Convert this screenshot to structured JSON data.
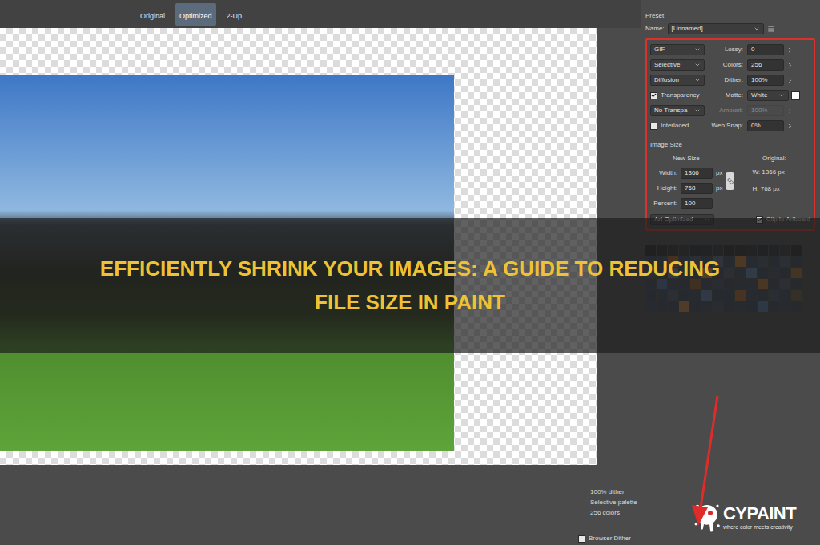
{
  "tabs": [
    {
      "label": "Original",
      "selected": false
    },
    {
      "label": "Optimized",
      "selected": true
    },
    {
      "label": "2-Up",
      "selected": false
    }
  ],
  "preset": {
    "label": "Preset",
    "name_label": "Name:",
    "name_value": "[Unnamed]"
  },
  "settings": [
    {
      "left": {
        "kind": "dropdown",
        "text": "GIF",
        "checked": false
      },
      "right": {
        "kind": "stepper",
        "label": "Lossy:",
        "value": "0",
        "disabled": false
      }
    },
    {
      "left": {
        "kind": "dropdown",
        "text": "Selective",
        "checked": false
      },
      "right": {
        "kind": "stepper",
        "label": "Colors:",
        "value": "256",
        "disabled": false
      }
    },
    {
      "left": {
        "kind": "dropdown",
        "text": "Diffusion",
        "checked": false
      },
      "right": {
        "kind": "stepper",
        "label": "Dither:",
        "value": "100%",
        "disabled": false
      }
    },
    {
      "left": {
        "kind": "checkbox",
        "text": "Transparency",
        "checked": true
      },
      "right": {
        "kind": "matte",
        "label": "Matte:",
        "value": "White",
        "disabled": false
      }
    },
    {
      "left": {
        "kind": "dropdown",
        "text": "No Transpa",
        "checked": false
      },
      "right": {
        "kind": "stepper",
        "label": "Amount:",
        "value": "100%",
        "disabled": true
      }
    },
    {
      "left": {
        "kind": "checkbox",
        "text": "Interlaced",
        "checked": false
      },
      "right": {
        "kind": "stepper",
        "label": "Web Snap:",
        "value": "0%",
        "disabled": false
      }
    }
  ],
  "image_size": {
    "title": "Image Size",
    "new_size": "New Size",
    "original": "Original:",
    "linked": true,
    "fields": [
      {
        "label": "Width:",
        "value": "1366",
        "unit": "px"
      },
      {
        "label": "Height:",
        "value": "768",
        "unit": "px"
      }
    ],
    "original_dims": [
      "W: 1366 px",
      "H: 768 px"
    ],
    "percent": {
      "label": "Percent:",
      "value": "100"
    },
    "quality": "Art Optimized",
    "clip": {
      "label": "Clip to Artboard",
      "checked": true
    }
  },
  "color_table": [
    "#262626",
    "#2b2b2b",
    "#2f2f2f",
    "#333333",
    "#2a2d31",
    "#2c2f34",
    "#303338",
    "#282a2e",
    "#2d2d2d",
    "#313131",
    "#292c30",
    "#2e3136",
    "#33363b",
    "#2b2b2b",
    "#3a4452",
    "#3d4858",
    "#a35f2a",
    "#3b4553",
    "#4a5565",
    "#3a4554",
    "#5a6a7e",
    "#3c4756",
    "#b8772f",
    "#3e4959",
    "#465262",
    "#3a4452",
    "#4e5b6c",
    "#3b4655",
    "#445162",
    "#3a4452",
    "#6a7d92",
    "#3c4757",
    "#3f4a5a",
    "#c28a3e",
    "#3a4554",
    "#4b5868",
    "#3d4858",
    "#5a7fa6",
    "#3b4655",
    "#424e5e",
    "#3a4452",
    "#9a6a35",
    "#3b4655",
    "#4a6f98",
    "#3c4757",
    "#3a4452",
    "#8c5a2a",
    "#3d4858",
    "#455262",
    "#3a4452",
    "#3c4757",
    "#3f4a5a",
    "#b0702f",
    "#3a4554",
    "#4d5a6b",
    "#3b4655",
    "#3a4452",
    "#3e4959",
    "#4c5969",
    "#3a4452",
    "#3c4757",
    "#5c7aa0",
    "#3a4554",
    "#3b4655",
    "#a8662c",
    "#3d4858",
    "#3a4452",
    "#465262",
    "#3c4757",
    "#6a5a40",
    "#3d4858",
    "#3a4452",
    "#3b4655",
    "#c08040",
    "#3a4554",
    "#3c4757",
    "#44505f",
    "#3a4452",
    "#3e4959",
    "#3b4655",
    "#5276a0",
    "#3a4452",
    "#3d4858",
    "#3a4452"
  ],
  "status": [
    "100% dither",
    "Selective palette",
    "256 colors"
  ],
  "browser_dither": {
    "label": "Browser Dither",
    "checked": false
  },
  "banner": {
    "lines": [
      "EFFICIENTLY SHRINK YOUR IMAGES: A GUIDE TO REDUCING",
      "FILE SIZE IN PAINT"
    ]
  },
  "logo": {
    "name": "CYPAINT",
    "tagline": "where color meets creativity"
  }
}
